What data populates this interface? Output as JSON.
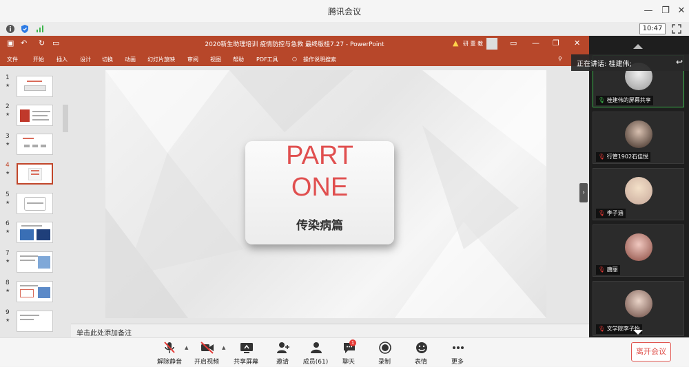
{
  "app": {
    "title": "腾讯会议"
  },
  "status": {
    "clock": "10:47"
  },
  "ppt": {
    "doc_title": "2020新生助理培训 疫情防控与急救 最终版桂7.27 - PowerPoint",
    "warning_user": "研 董 教",
    "tabs": [
      "文件",
      "开始",
      "插入",
      "设计",
      "切换",
      "动画",
      "幻灯片放映",
      "审阅",
      "视图",
      "帮助",
      "PDF工具"
    ],
    "tell_me": "操作说明搜索",
    "slide_numbers": [
      "1",
      "2",
      "3",
      "4",
      "5",
      "6",
      "7",
      "8",
      "9"
    ],
    "slide": {
      "line1": "PART",
      "line2": "ONE",
      "subtitle": "传染病篇"
    },
    "notes_placeholder": "单击此处添加备注"
  },
  "meeting": {
    "speaking_label": "正在讲话: 桂建伟;",
    "participants": [
      {
        "name": "桂建伟的屏幕共享"
      },
      {
        "name": "行管1902石佳悦"
      },
      {
        "name": "李子涵"
      },
      {
        "name": "唐丽"
      },
      {
        "name": "文学院李子怡"
      }
    ]
  },
  "toolbar": {
    "items": [
      {
        "label": "解除静音"
      },
      {
        "label": "开启视频"
      },
      {
        "label": "共享屏幕"
      },
      {
        "label": "邀请"
      },
      {
        "label": "成员(61)"
      },
      {
        "label": "聊天"
      },
      {
        "label": "录制"
      },
      {
        "label": "表情"
      },
      {
        "label": "更多"
      }
    ],
    "chat_badge": "1",
    "leave_label": "离开会议"
  },
  "colors": {
    "ppt_accent": "#b7472a",
    "slide_title": "#e04f4f",
    "leave": "#e0544f",
    "active_speaker": "#3bb54a"
  }
}
